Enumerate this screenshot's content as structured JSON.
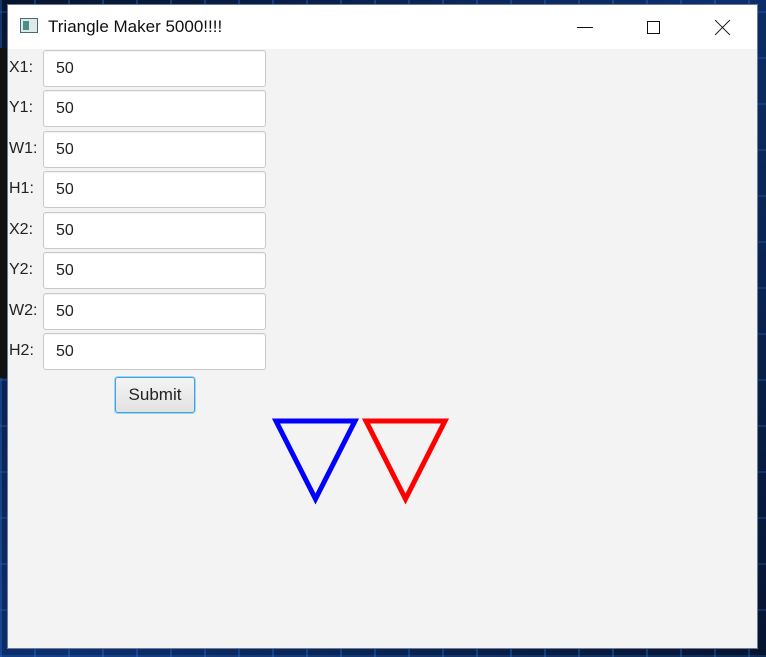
{
  "window": {
    "title": "Triangle Maker 5000!!!!",
    "minimize_icon": "minimize-icon",
    "maximize_icon": "maximize-icon",
    "close_icon": "close-icon"
  },
  "form": {
    "fields": [
      {
        "label": "X1:",
        "value": "50"
      },
      {
        "label": "Y1:",
        "value": "50"
      },
      {
        "label": "W1:",
        "value": "50"
      },
      {
        "label": "H1:",
        "value": "50"
      },
      {
        "label": "X2:",
        "value": "50"
      },
      {
        "label": "Y2:",
        "value": "50"
      },
      {
        "label": "W2:",
        "value": "50"
      },
      {
        "label": "H2:",
        "value": "50"
      }
    ],
    "submit_label": "Submit"
  },
  "canvas": {
    "triangles": [
      {
        "color": "#0000ff"
      },
      {
        "color": "#ff0000"
      }
    ]
  }
}
